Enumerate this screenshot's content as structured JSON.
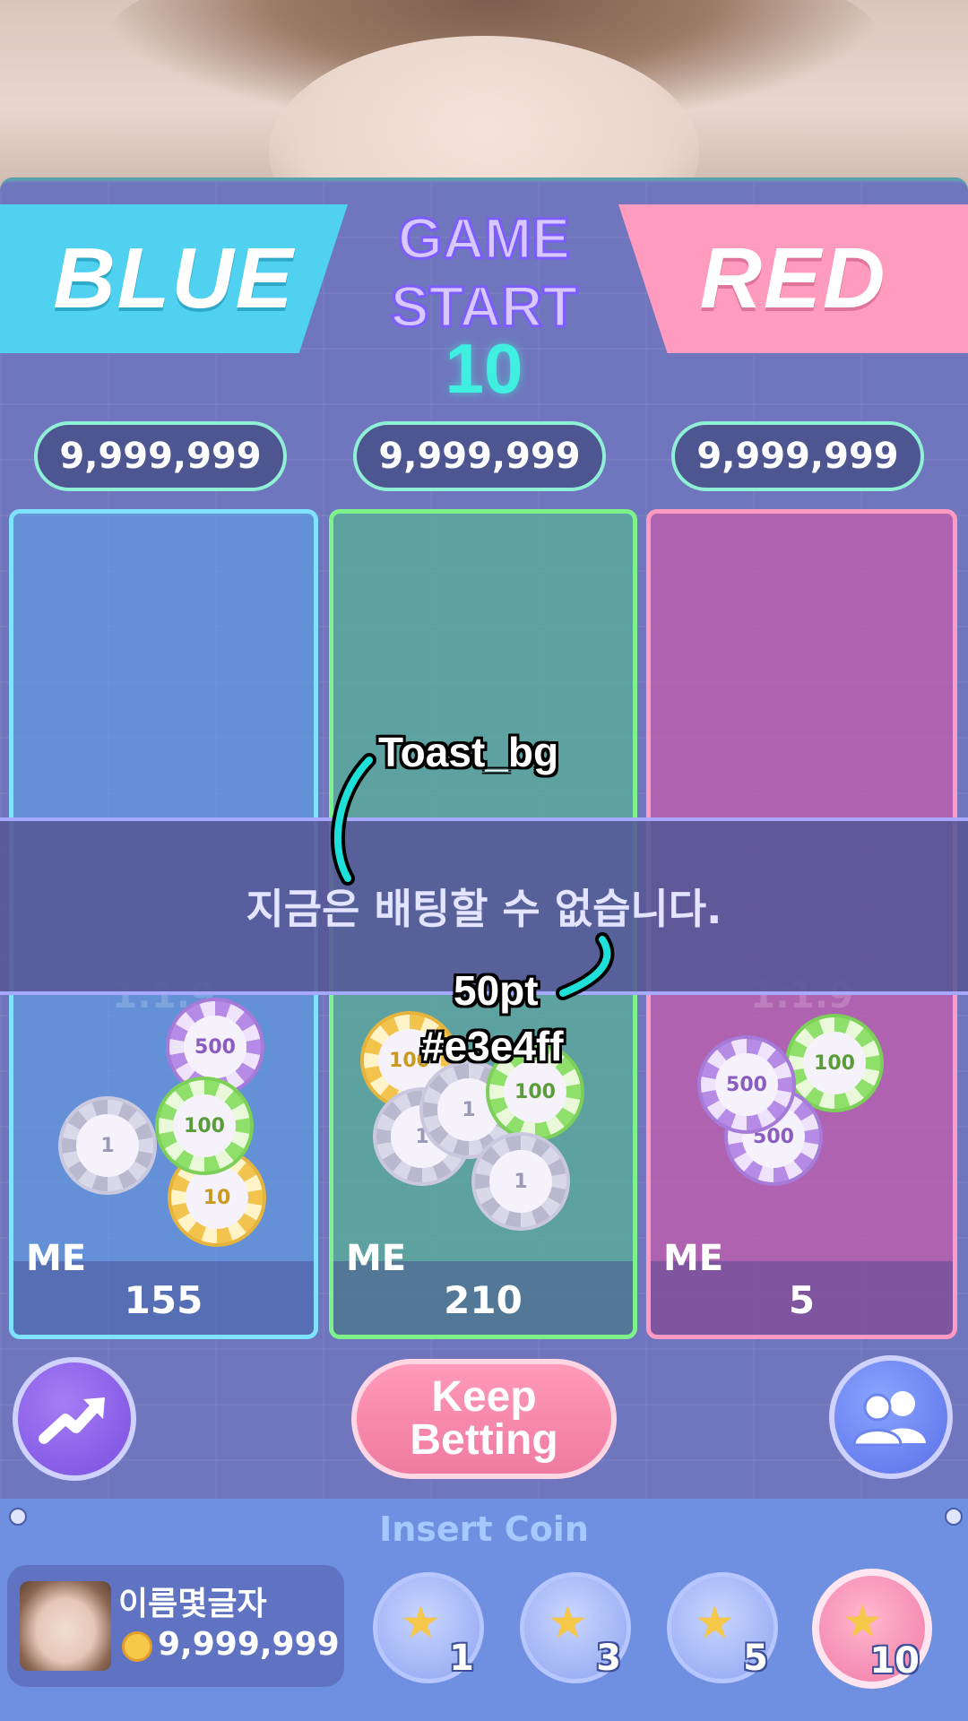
{
  "teams": {
    "blue": "BLUE",
    "red": "RED"
  },
  "status": {
    "line1": "GAME",
    "line2": "START",
    "countdown": "10"
  },
  "totals": [
    "9,999,999",
    "9,999,999",
    "9,999,999"
  ],
  "columns": [
    {
      "ratio": "1:1.9",
      "me_label": "ME",
      "my_bet": "155"
    },
    {
      "ratio": "",
      "me_label": "ME",
      "my_bet": "210"
    },
    {
      "ratio": "1:1.9",
      "me_label": "ME",
      "my_bet": "5"
    }
  ],
  "chips": {
    "blue": [
      "500",
      "100",
      "1",
      "10"
    ],
    "tie": [
      "100",
      "1",
      "1",
      "100",
      "1"
    ],
    "red": [
      "100",
      "500",
      "500"
    ]
  },
  "toast": {
    "message": "지금은 배팅할 수 없습니다."
  },
  "annotations": {
    "toast_label": "Toast_bg",
    "size": "50pt",
    "color": "#e3e4ff"
  },
  "actions": {
    "keep_line1": "Keep",
    "keep_line2": "Betting"
  },
  "footer": {
    "insert_coin": "Insert Coin",
    "profile_name": "이름몇글자",
    "balance": "9,999,999",
    "coin_options": [
      "1",
      "3",
      "5",
      "10"
    ]
  }
}
